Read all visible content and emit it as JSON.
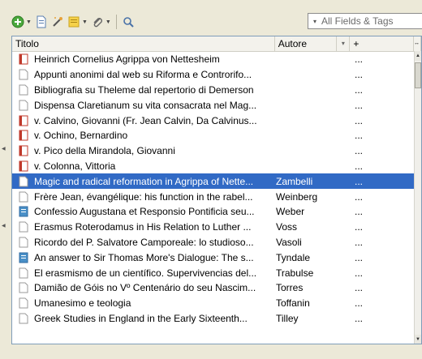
{
  "toolbar": {
    "search": {
      "mode": "▾",
      "placeholder": "All Fields & Tags"
    }
  },
  "columns": {
    "title": "Titolo",
    "author": "Autore",
    "sort": "▾",
    "extra": "+",
    "picker": "↔"
  },
  "colors": {
    "selected": "#316ac5",
    "book": "#c0392b",
    "journal": "#4a90c8"
  },
  "rows": [
    {
      "icon": "book",
      "title": "Heinrich Cornelius Agrippa von Nettesheim",
      "author": "",
      "extra": "..."
    },
    {
      "icon": "document",
      "title": "Appunti anonimi dal web su Riforma e Controrifo...",
      "author": "",
      "extra": "..."
    },
    {
      "icon": "document",
      "title": "Bibliografia su Theleme dal repertorio di Demerson",
      "author": "",
      "extra": "..."
    },
    {
      "icon": "document",
      "title": "Dispensa Claretianum su vita consacrata nel Mag...",
      "author": "",
      "extra": "..."
    },
    {
      "icon": "book",
      "title": "v. Calvino, Giovanni (Fr. Jean Calvin, Da Calvinus...",
      "author": "",
      "extra": "..."
    },
    {
      "icon": "book",
      "title": "v. Ochino, Bernardino",
      "author": "",
      "extra": "..."
    },
    {
      "icon": "book",
      "title": "v. Pico della Mirandola, Giovanni",
      "author": "",
      "extra": "..."
    },
    {
      "icon": "book",
      "title": "v. Colonna, Vittoria",
      "author": "",
      "extra": "..."
    },
    {
      "icon": "document",
      "title": "Magic and radical reformation in Agrippa of Nette...",
      "author": "Zambelli",
      "extra": "...",
      "selected": true
    },
    {
      "icon": "document",
      "title": "Frère Jean, évangélique: his function in the rabel...",
      "author": "Weinberg",
      "extra": "..."
    },
    {
      "icon": "journal",
      "title": "Confessio Augustana  et Responsio Pontificia seu...",
      "author": "Weber",
      "extra": "..."
    },
    {
      "icon": "document",
      "title": "Erasmus Roterodamus in His Relation to Luther ...",
      "author": "Voss",
      "extra": "..."
    },
    {
      "icon": "document",
      "title": "Ricordo del P. Salvatore Camporeale: lo studioso...",
      "author": "Vasoli",
      "extra": "..."
    },
    {
      "icon": "journal",
      "title": "An answer to Sir Thomas More's Dialogue: The s...",
      "author": "Tyndale",
      "extra": "..."
    },
    {
      "icon": "document",
      "title": "El erasmismo de un científico. Supervivencias del...",
      "author": "Trabulse",
      "extra": "..."
    },
    {
      "icon": "document",
      "title": "Damião de Góis no Vº Centenário do seu Nascim...",
      "author": "Torres",
      "extra": "..."
    },
    {
      "icon": "document",
      "title": "Umanesimo e teologia",
      "author": "Toffanin",
      "extra": "..."
    },
    {
      "icon": "document",
      "title": "Greek Studies in England in the Early Sixteenth...",
      "author": "Tilley",
      "extra": "..."
    }
  ]
}
